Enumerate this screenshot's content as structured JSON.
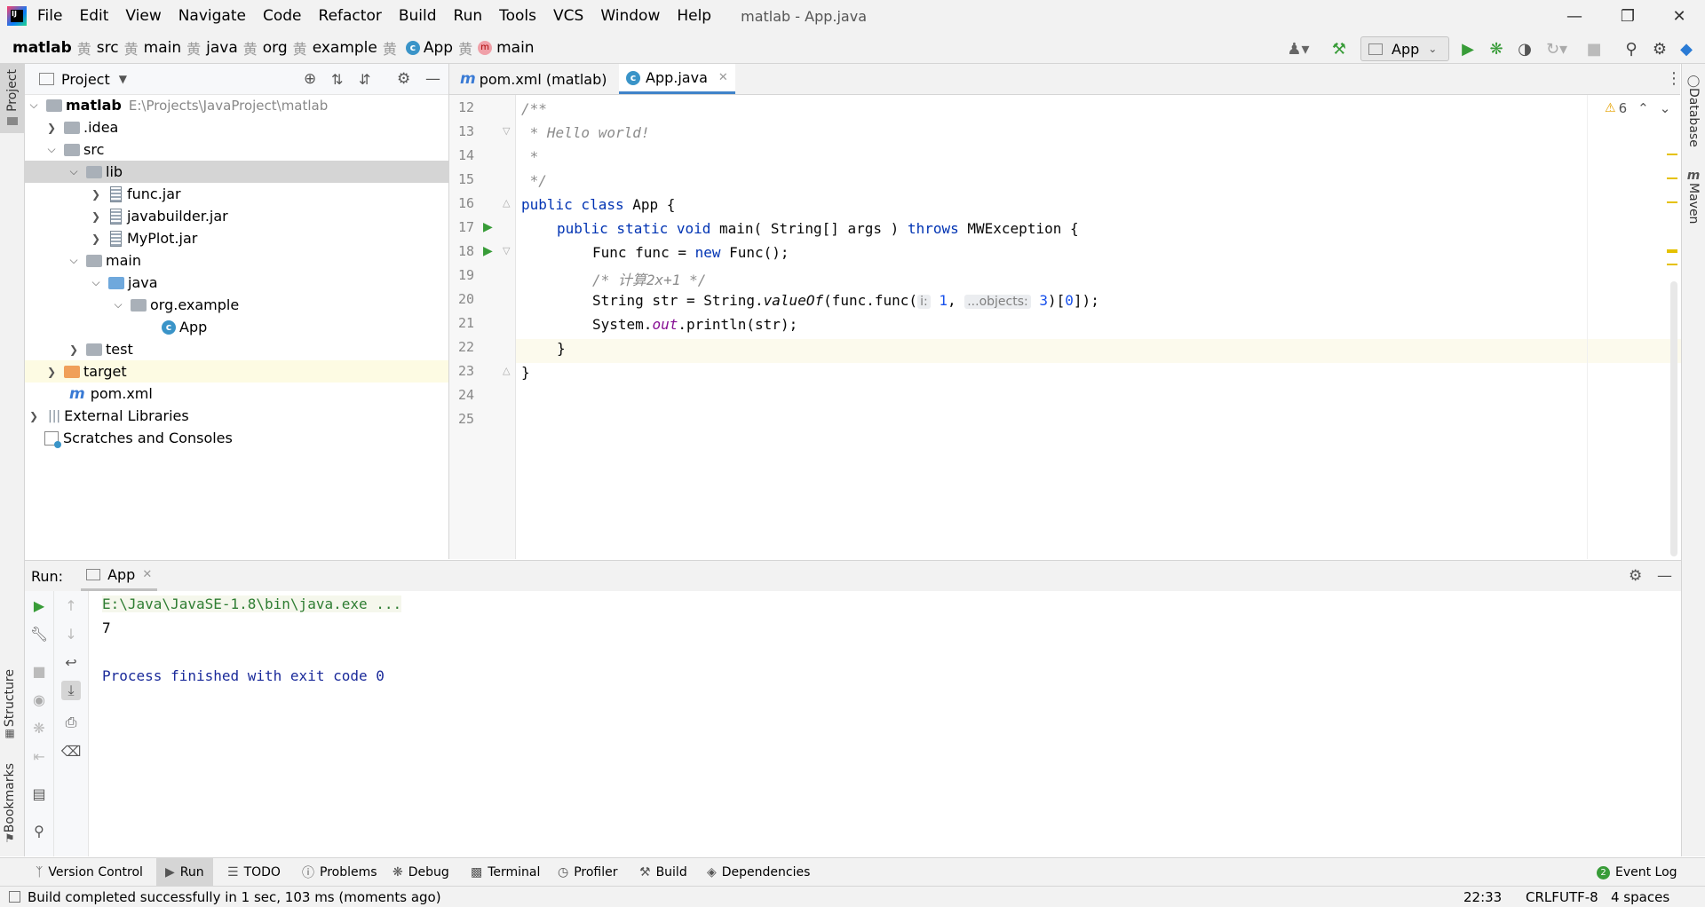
{
  "window": {
    "title": "matlab - App.java",
    "menu": [
      "File",
      "Edit",
      "View",
      "Navigate",
      "Code",
      "Refactor",
      "Build",
      "Run",
      "Tools",
      "VCS",
      "Window",
      "Help"
    ]
  },
  "breadcrumb": [
    "matlab",
    "src",
    "main",
    "java",
    "org",
    "example",
    "App",
    "main"
  ],
  "toolbar": {
    "run_config": "App"
  },
  "project": {
    "title": "Project",
    "root_name": "matlab",
    "root_path": "E:\\Projects\\JavaProject\\matlab",
    "items": [
      ".idea",
      "src",
      "lib",
      "func.jar",
      "javabuilder.jar",
      "MyPlot.jar",
      "main",
      "java",
      "org.example",
      "App",
      "test",
      "target",
      "pom.xml",
      "External Libraries",
      "Scratches and Consoles"
    ]
  },
  "editor": {
    "tabs": [
      "pom.xml (matlab)",
      "App.java"
    ],
    "warnings": "6",
    "line_numbers": [
      "12",
      "13",
      "14",
      "15",
      "16",
      "17",
      "18",
      "19",
      "20",
      "21",
      "22",
      "23",
      "24",
      "25"
    ],
    "code": {
      "l13": "/**",
      "l14": " * Hello world!",
      "l15": " *",
      "l16": " */",
      "l17_kw": "public class",
      "l17_rest": " App {",
      "l18_kw1": "public static void",
      "l18_mid": " main( String[] args ) ",
      "l18_kw2": "throws",
      "l18_end": " MWException {",
      "l19_a": "Func func = ",
      "l19_kw": "new",
      "l19_b": " Func();",
      "l20": "/* 计算2x+1 */",
      "l21_a": "String str = String.",
      "l21_it": "valueOf",
      "l21_b": "(func.func(",
      "l21_hint1": "i:",
      "l21_n1": "1",
      "l21_c": ", ",
      "l21_hint2": "...objects:",
      "l21_n2": "3",
      "l21_d": ")[",
      "l21_n3": "0",
      "l21_e": "]);",
      "l22_a": "System.",
      "l22_fld": "out",
      "l22_b": ".println(str);",
      "l23": "}",
      "l24": "}"
    }
  },
  "run": {
    "label": "Run:",
    "tab": "App",
    "output": [
      "E:\\Java\\JavaSE-1.8\\bin\\java.exe ...",
      "7",
      "Process finished with exit code 0"
    ]
  },
  "tool_windows": {
    "left": [
      "Project",
      "Structure",
      "Bookmarks"
    ],
    "right": [
      "Database",
      "Maven"
    ],
    "bottom": [
      "Version Control",
      "Run",
      "TODO",
      "Problems",
      "Debug",
      "Terminal",
      "Profiler",
      "Build",
      "Dependencies"
    ],
    "event_log": "Event Log",
    "event_count": "2"
  },
  "status": {
    "message": "Build completed successfully in 1 sec, 103 ms (moments ago)",
    "position": "22:33",
    "line_sep": "CRLF",
    "encoding": "UTF-8",
    "indent": "4 spaces"
  },
  "colors": {
    "accent": "#4083c9",
    "keyword": "#0033b3",
    "comment": "#8c8c8c",
    "run_green": "#389c38"
  }
}
